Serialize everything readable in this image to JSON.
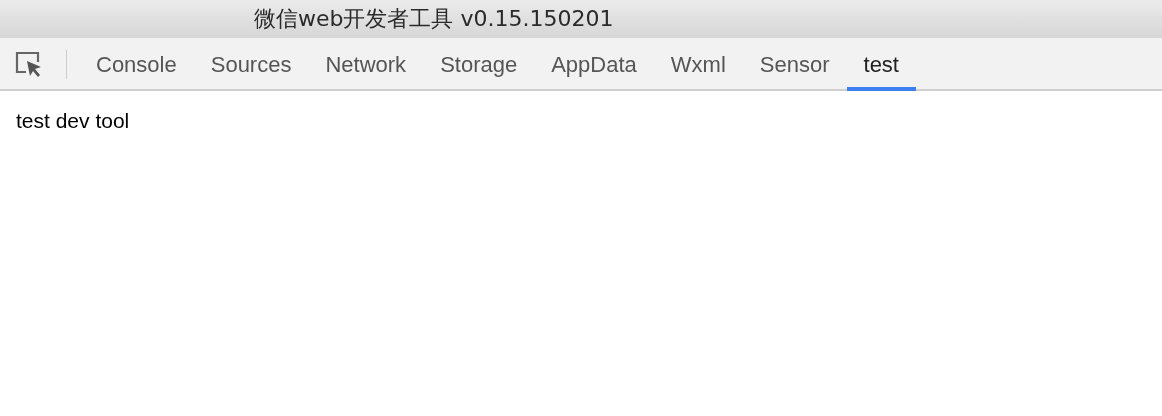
{
  "window": {
    "title": "微信web开发者工具 v0.15.150201"
  },
  "tabs": [
    {
      "label": "Console",
      "selected": false
    },
    {
      "label": "Sources",
      "selected": false
    },
    {
      "label": "Network",
      "selected": false
    },
    {
      "label": "Storage",
      "selected": false
    },
    {
      "label": "AppData",
      "selected": false
    },
    {
      "label": "Wxml",
      "selected": false
    },
    {
      "label": "Sensor",
      "selected": false
    },
    {
      "label": "test",
      "selected": true
    }
  ],
  "content": {
    "text": "test dev tool"
  }
}
